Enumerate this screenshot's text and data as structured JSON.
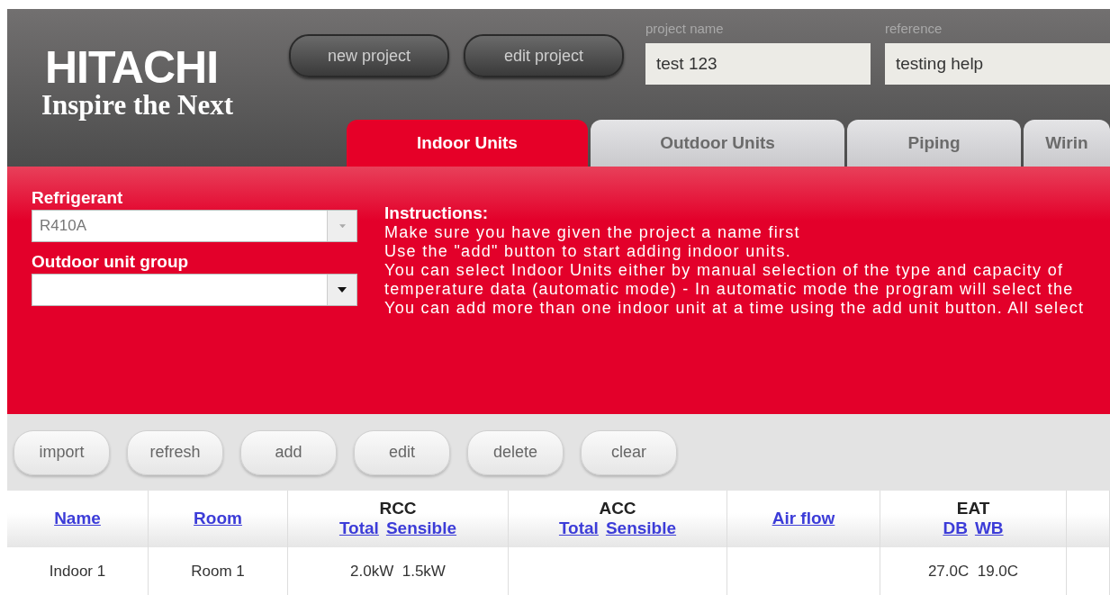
{
  "logo": {
    "brand": "HITACHI",
    "tagline": "Inspire the Next"
  },
  "header_buttons": [
    "new project",
    "edit project"
  ],
  "fields": [
    {
      "label": "project name",
      "value": "test 123"
    },
    {
      "label": "reference",
      "value": "testing help"
    }
  ],
  "tabs": [
    {
      "label": "Indoor Units",
      "selected": true
    },
    {
      "label": "Outdoor Units",
      "selected": false
    },
    {
      "label": "Piping",
      "selected": false
    },
    {
      "label": "Wirin",
      "selected": false
    }
  ],
  "selects": [
    {
      "label": "Refrigerant",
      "value": "R410A",
      "disabled": true
    },
    {
      "label": "Outdoor unit group",
      "disabled": false
    }
  ],
  "instructions": {
    "title": "Instructions:",
    "lines": [
      "Make sure you have given the project a name first",
      "Use the \"add\" button to start adding indoor units.",
      "You can select Indoor Units either by manual selection of the type and capacity of",
      "temperature data (automatic mode) - In automatic mode the program will select the",
      "You can add more than one indoor unit at a time using the add unit button. All select"
    ]
  },
  "toolbar_buttons": [
    "import",
    "refresh",
    "add",
    "edit",
    "delete",
    "clear"
  ],
  "table": {
    "columns": [
      {
        "label": "Name"
      },
      {
        "label": "Room"
      },
      {
        "label": "RCC",
        "sub": [
          "Total",
          "Sensible"
        ]
      },
      {
        "label": "ACC",
        "sub": [
          "Total",
          "Sensible"
        ]
      },
      {
        "label": "Air flow"
      },
      {
        "label": "EAT",
        "sub": [
          "DB",
          "WB"
        ]
      }
    ],
    "rows": [
      {
        "cells": [
          {
            "values": [
              "Indoor 1"
            ]
          },
          {
            "values": [
              "Room 1"
            ]
          },
          {
            "values": [
              "2.0kW",
              "1.5kW"
            ]
          },
          {},
          {},
          {
            "values": [
              "27.0C",
              "19.0C"
            ]
          }
        ]
      }
    ]
  }
}
